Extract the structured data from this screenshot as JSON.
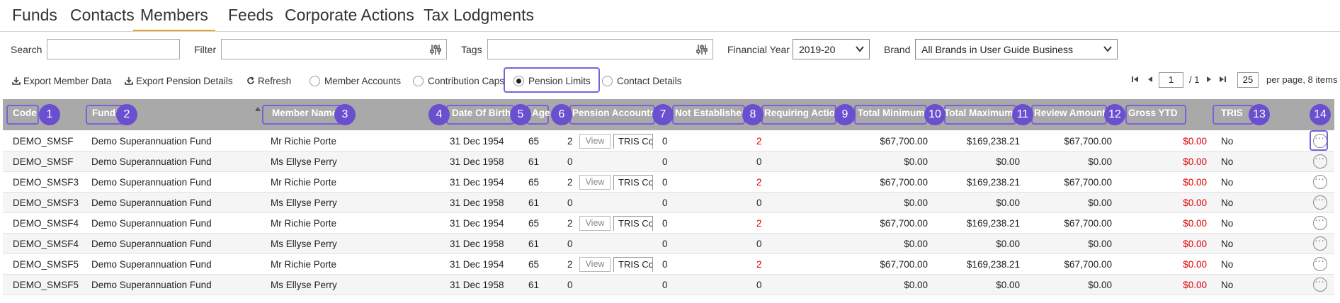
{
  "nav": {
    "tabs": [
      {
        "label": "Funds"
      },
      {
        "label": "Contacts"
      },
      {
        "label": "Members"
      },
      {
        "label": "Feeds"
      },
      {
        "label": "Corporate Actions"
      },
      {
        "label": "Tax Lodgments"
      }
    ],
    "active_tab": "Members"
  },
  "filters": {
    "search_label": "Search",
    "search_value": "",
    "filter_label": "Filter",
    "filter_value": "",
    "tags_label": "Tags",
    "tags_value": "",
    "financial_year_label": "Financial Year",
    "financial_year_value": "2019-20",
    "brand_label": "Brand",
    "brand_value": "All Brands in User Guide Business"
  },
  "actions": {
    "export_member": "Export Member Data",
    "export_pension": "Export Pension Details",
    "refresh": "Refresh",
    "radios": [
      {
        "label": "Member Accounts",
        "selected": false
      },
      {
        "label": "Contribution Caps",
        "selected": false
      },
      {
        "label": "Pension Limits",
        "selected": true
      },
      {
        "label": "Contact Details",
        "selected": false
      }
    ]
  },
  "pager": {
    "page": "1",
    "total_pages": "/ 1",
    "per_page": "25",
    "per_page_text": "per page, 8 items"
  },
  "table": {
    "headers": [
      {
        "label": "Code",
        "badge": "1"
      },
      {
        "label": "Fund",
        "badge": "2"
      },
      {
        "label": "Member Name",
        "badge": "3"
      },
      {
        "label": "Date Of Birth",
        "badge": "4"
      },
      {
        "label": "Age",
        "badge": "5"
      },
      {
        "label": "Pension Accounts",
        "badge": "6"
      },
      {
        "label": "Not Established",
        "badge": "7"
      },
      {
        "label": "Requiring Action",
        "badge": "8"
      },
      {
        "label": "Total Minimums",
        "badge": "9"
      },
      {
        "label": "Total Maximums",
        "badge": "10"
      },
      {
        "label": "Review Amount",
        "badge": "11"
      },
      {
        "label": "Gross YTD",
        "badge": "12"
      },
      {
        "label": "TRIS",
        "badge": "13"
      },
      {
        "label": "",
        "badge": "14"
      }
    ],
    "view_label": "View",
    "tris_label": "TRIS Con",
    "rows": [
      {
        "code": "DEMO_SMSF",
        "fund": "Demo Superannuation Fund",
        "member": "Mr Richie Porte",
        "dob": "31 Dec 1954",
        "age": "65",
        "pension": "2",
        "has_buttons": true,
        "not_established": "0",
        "requiring": "2",
        "min": "$67,700.00",
        "max": "$169,238.21",
        "review": "$67,700.00",
        "gross": "$0.00",
        "tris": "No"
      },
      {
        "code": "DEMO_SMSF",
        "fund": "Demo Superannuation Fund",
        "member": "Ms Ellyse Perry",
        "dob": "31 Dec 1958",
        "age": "61",
        "pension": "0",
        "has_buttons": false,
        "not_established": "0",
        "requiring": "0",
        "min": "$0.00",
        "max": "$0.00",
        "review": "$0.00",
        "gross": "$0.00",
        "tris": "No"
      },
      {
        "code": "DEMO_SMSF3",
        "fund": "Demo Superannuation Fund",
        "member": "Mr Richie Porte",
        "dob": "31 Dec 1954",
        "age": "65",
        "pension": "2",
        "has_buttons": true,
        "not_established": "0",
        "requiring": "2",
        "min": "$67,700.00",
        "max": "$169,238.21",
        "review": "$67,700.00",
        "gross": "$0.00",
        "tris": "No"
      },
      {
        "code": "DEMO_SMSF3",
        "fund": "Demo Superannuation Fund",
        "member": "Ms Ellyse Perry",
        "dob": "31 Dec 1958",
        "age": "61",
        "pension": "0",
        "has_buttons": false,
        "not_established": "0",
        "requiring": "0",
        "min": "$0.00",
        "max": "$0.00",
        "review": "$0.00",
        "gross": "$0.00",
        "tris": "No"
      },
      {
        "code": "DEMO_SMSF4",
        "fund": "Demo Superannuation Fund",
        "member": "Mr Richie Porte",
        "dob": "31 Dec 1954",
        "age": "65",
        "pension": "2",
        "has_buttons": true,
        "not_established": "0",
        "requiring": "2",
        "min": "$67,700.00",
        "max": "$169,238.21",
        "review": "$67,700.00",
        "gross": "$0.00",
        "tris": "No"
      },
      {
        "code": "DEMO_SMSF4",
        "fund": "Demo Superannuation Fund",
        "member": "Ms Ellyse Perry",
        "dob": "31 Dec 1958",
        "age": "61",
        "pension": "0",
        "has_buttons": false,
        "not_established": "0",
        "requiring": "0",
        "min": "$0.00",
        "max": "$0.00",
        "review": "$0.00",
        "gross": "$0.00",
        "tris": "No"
      },
      {
        "code": "DEMO_SMSF5",
        "fund": "Demo Superannuation Fund",
        "member": "Mr Richie Porte",
        "dob": "31 Dec 1954",
        "age": "65",
        "pension": "2",
        "has_buttons": true,
        "not_established": "0",
        "requiring": "2",
        "min": "$67,700.00",
        "max": "$169,238.21",
        "review": "$67,700.00",
        "gross": "$0.00",
        "tris": "No"
      },
      {
        "code": "DEMO_SMSF5",
        "fund": "Demo Superannuation Fund",
        "member": "Ms Ellyse Perry",
        "dob": "31 Dec 1958",
        "age": "61",
        "pension": "0",
        "has_buttons": false,
        "not_established": "0",
        "requiring": "0",
        "min": "$0.00",
        "max": "$0.00",
        "review": "$0.00",
        "gross": "$0.00",
        "tris": "No"
      }
    ]
  },
  "colors": {
    "accent": "#f0a31c",
    "highlight": "#7b61d9",
    "badge": "#6a4fcf",
    "header_bg": "#a9a9a9",
    "negative": "#e00000"
  }
}
